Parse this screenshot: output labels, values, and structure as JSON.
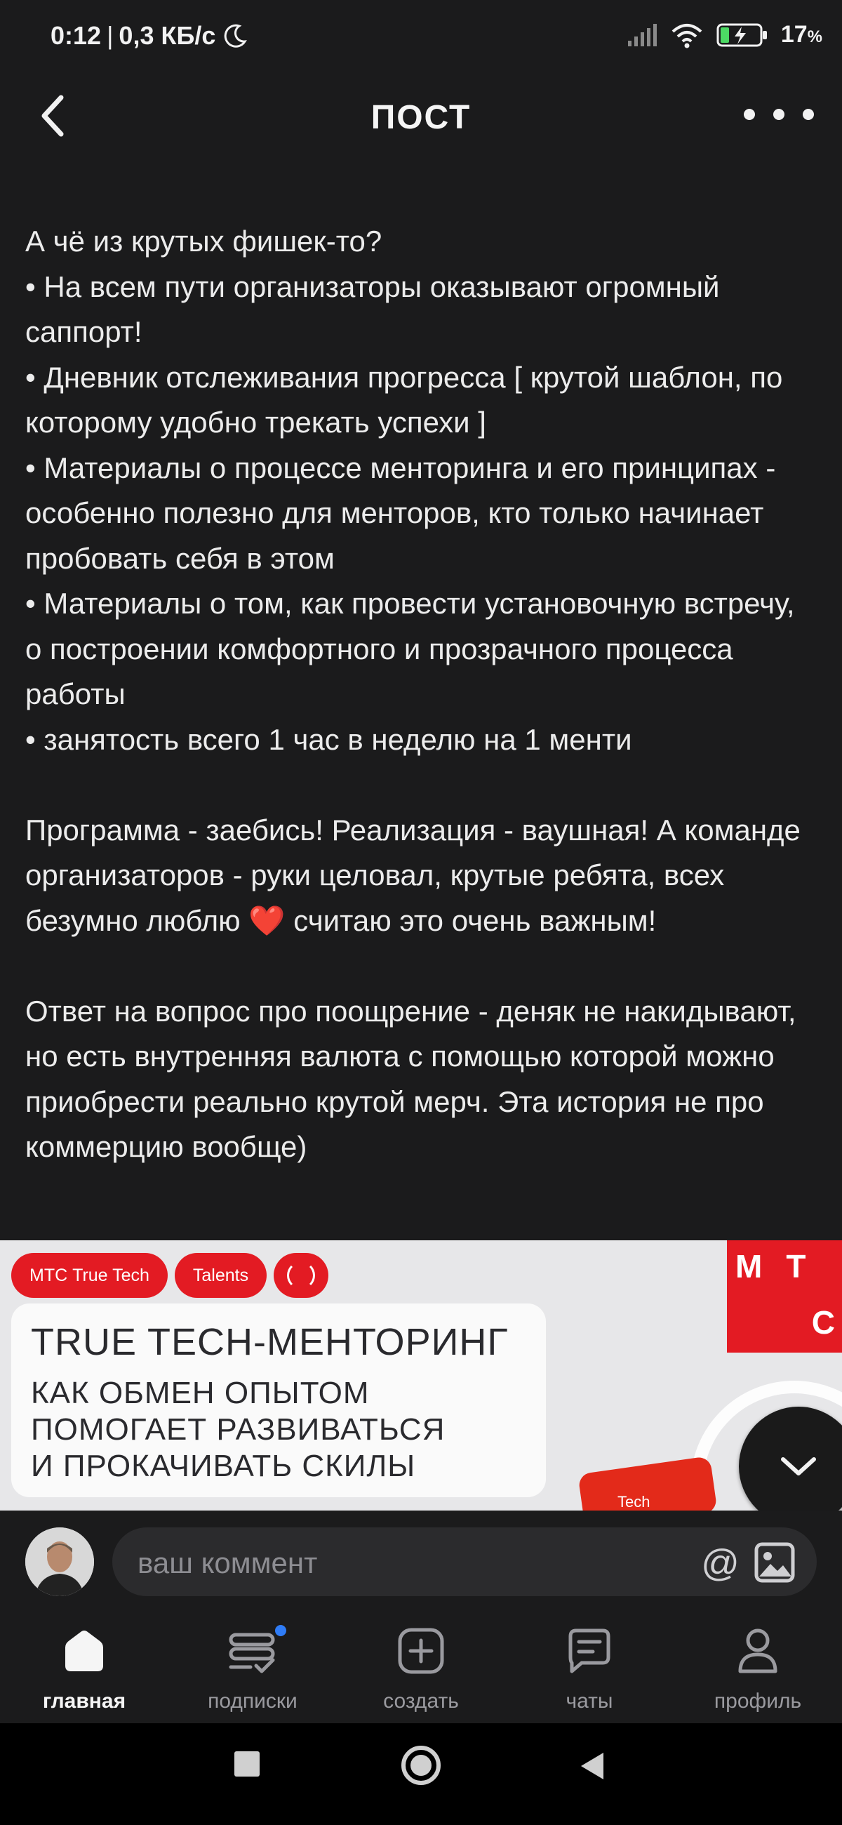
{
  "status_bar": {
    "time": "0:12",
    "separator": "|",
    "net_speed": "0,3 КБ/с",
    "battery": "17",
    "battery_unit": "%",
    "icons": [
      "moon-icon",
      "signal-icon",
      "wifi-icon",
      "battery-charging-icon"
    ]
  },
  "header": {
    "title": "ПОСТ",
    "back_icon": "chevron-left-icon",
    "more_icon": "more-dots-icon"
  },
  "post": {
    "paragraph_1": [
      "А чё из крутых фишек-то?",
      "• На всем пути организаторы оказывают огромный саппорт!",
      "• Дневник отслеживания прогресса [ крутой шаблон, по которому удобно трекать успехи ]",
      "• Материалы о процессе менторинга и его принципах - особенно полезно для менторов, кто только начинает пробовать себя в этом",
      "• Материалы о том, как провести установочную встречу, о построении комфортного и прозрачного процесса работы",
      "• занятость всего 1 час в неделю на 1 менти"
    ],
    "paragraph_2_before_heart": "Программа - заебись! Реализация - ваушная! А команде организаторов - руки целовал, крутые ребята, всех безумно люблю ",
    "heart_emoji": "❤️",
    "paragraph_2_after_heart": " считаю это очень важным!",
    "paragraph_3": "Ответ на вопрос про поощрение - деняк не накидывают, но есть внутренняя валюта с помощью которой можно приобрести реально крутой мерч. Эта история не про коммерцию вообще)"
  },
  "banner": {
    "chips": [
      "МТС True Tech",
      "Talents"
    ],
    "title": "TRUE TECH-МЕНТОРИНГ",
    "subtitle": "КАК ОБМЕН ОПЫТОМ\nПОМОГАЕТ РАЗВИВАТЬСЯ\nИ ПРОКАЧИВАТЬ СКИЛЫ",
    "logo_line1": "МТ",
    "logo_line2": "С",
    "device_text": "Tech",
    "accent_color": "#e31b23"
  },
  "comment": {
    "placeholder": "ваш коммент"
  },
  "bottom_nav": {
    "items": [
      {
        "label": "главная",
        "icon": "home-icon",
        "active": true
      },
      {
        "label": "подписки",
        "icon": "subscriptions-icon",
        "active": false
      },
      {
        "label": "создать",
        "icon": "create-plus-icon",
        "active": false
      },
      {
        "label": "чаты",
        "icon": "chat-icon",
        "active": false
      },
      {
        "label": "профиль",
        "icon": "profile-icon",
        "active": false
      }
    ]
  }
}
